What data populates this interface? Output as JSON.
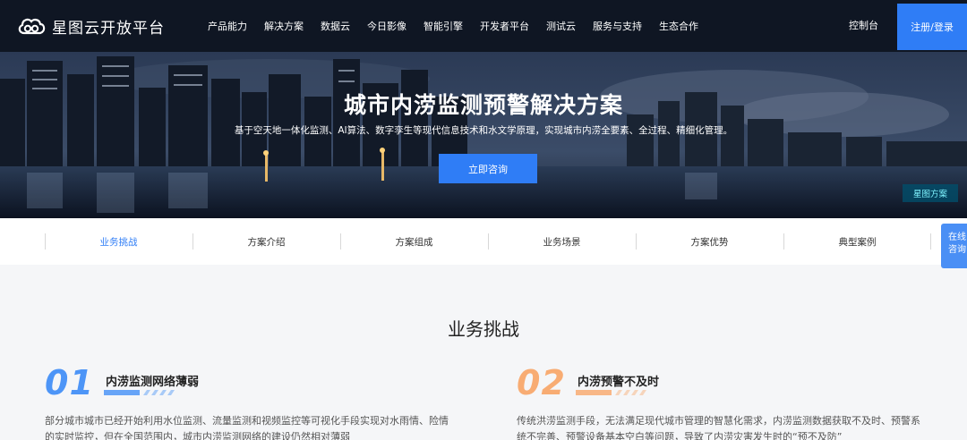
{
  "header": {
    "logo_text": "星图云开放平台",
    "nav": [
      "产品能力",
      "解决方案",
      "数据云",
      "今日影像",
      "智能引擎",
      "开发者平台",
      "测试云",
      "服务与支持",
      "生态合作"
    ],
    "console": "控制台",
    "register": "注册/登录"
  },
  "hero": {
    "title": "城市内涝监测预警解决方案",
    "subtitle": "基于空天地一体化监测、AI算法、数字孪生等现代信息技术和水文学原理，实现城市内涝全要素、全过程、精细化管理。",
    "cta": "立即咨询",
    "badge": "星图方案"
  },
  "tabs": {
    "items": [
      "业务挑战",
      "方案介绍",
      "方案组成",
      "业务场景",
      "方案优势",
      "典型案例"
    ],
    "active_index": 0
  },
  "float_consult": {
    "line1": "在线",
    "line2": "咨询"
  },
  "section": {
    "title": "业务挑战",
    "challenges": [
      {
        "num": "01",
        "title": "内涝监测网络薄弱",
        "text_line1": "部分城市城市已经开始利用水位监测、流量监测和视频监控等可视化手段实现对水雨情、险情",
        "text_line2": "的实时监控，但在全国范围内，城市内涝监测网络的建设仍然相对薄弱"
      },
      {
        "num": "02",
        "title": "内涝预警不及时",
        "text_line1": "传统洪涝监测手段，无法满足现代城市管理的智慧化需求，内涝监测数据获取不及时、预警系",
        "text_line2": "统不完善、预警设备基本空白等问题，导致了内涝灾害发生时的“预不及防”"
      }
    ]
  },
  "colors": {
    "accent": "#2f7df6",
    "header_bg": "#0f1623",
    "num_blue": "#4d95f7",
    "num_orange": "#f8ac73"
  }
}
